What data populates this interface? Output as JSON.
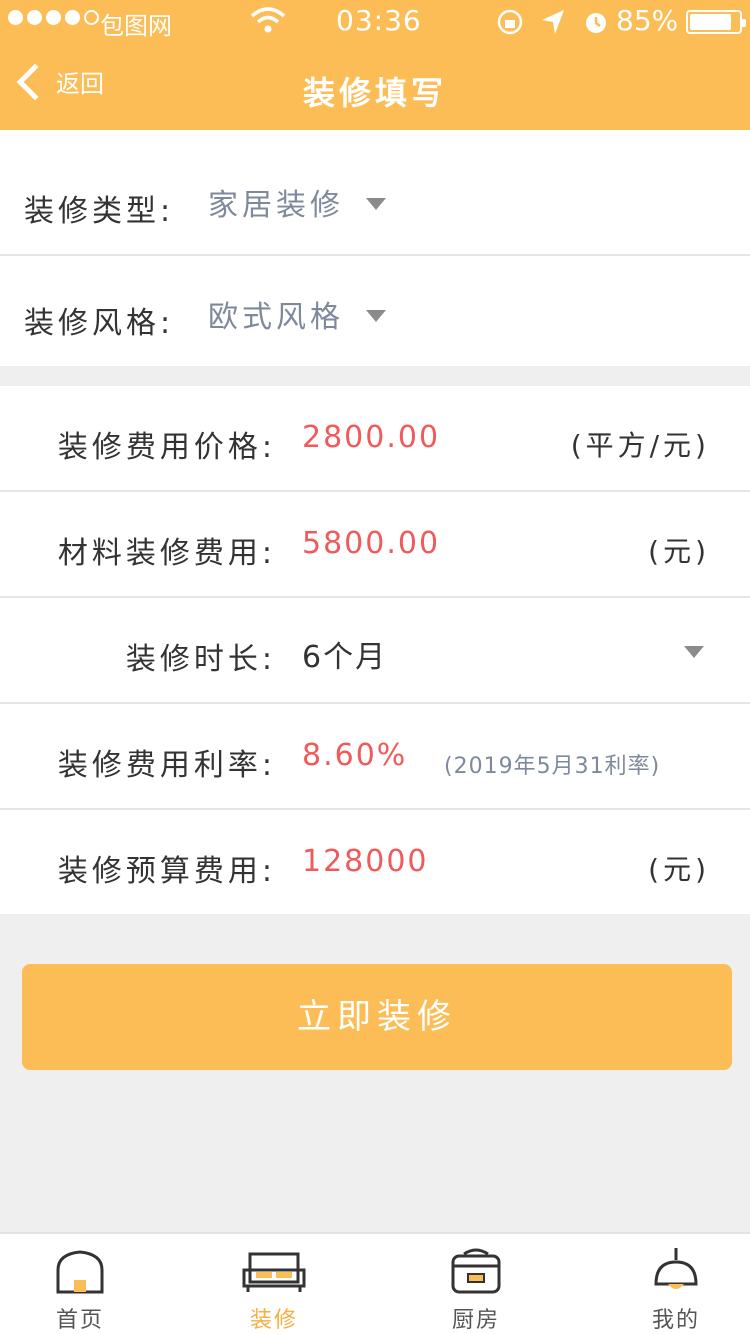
{
  "status_bar": {
    "carrier": "包图网",
    "time": "03:36",
    "battery": "85%",
    "battery_level": 0.85
  },
  "nav": {
    "back_label": "返回",
    "title": "装修填写"
  },
  "selections": [
    {
      "label": "装修类型:",
      "value": "家居装修"
    },
    {
      "label": "装修风格:",
      "value": "欧式风格"
    }
  ],
  "fees": {
    "price": {
      "label": "装修费用价格:",
      "value": "2800.00",
      "unit": "(平方/元)"
    },
    "material": {
      "label": "材料装修费用:",
      "value": "5800.00",
      "unit": "(元)"
    },
    "duration": {
      "label": "装修时长:",
      "value": "6个月"
    },
    "rate": {
      "label": "装修费用利率:",
      "value": "8.60%",
      "note": "(2019年5月31利率)"
    },
    "budget": {
      "label": "装修预算费用:",
      "value": "128000",
      "unit": "(元)"
    }
  },
  "cta_label": "立即装修",
  "tabs": [
    {
      "label": "首页",
      "icon": "home-icon",
      "active": false
    },
    {
      "label": "装修",
      "icon": "sofa-icon",
      "active": true
    },
    {
      "label": "厨房",
      "icon": "rice-cooker-icon",
      "active": false
    },
    {
      "label": "我的",
      "icon": "lamp-icon",
      "active": false
    }
  ],
  "colors": {
    "brand": "#fdbd56",
    "value_red": "#f05a5a",
    "muted": "#7e8a9c"
  }
}
